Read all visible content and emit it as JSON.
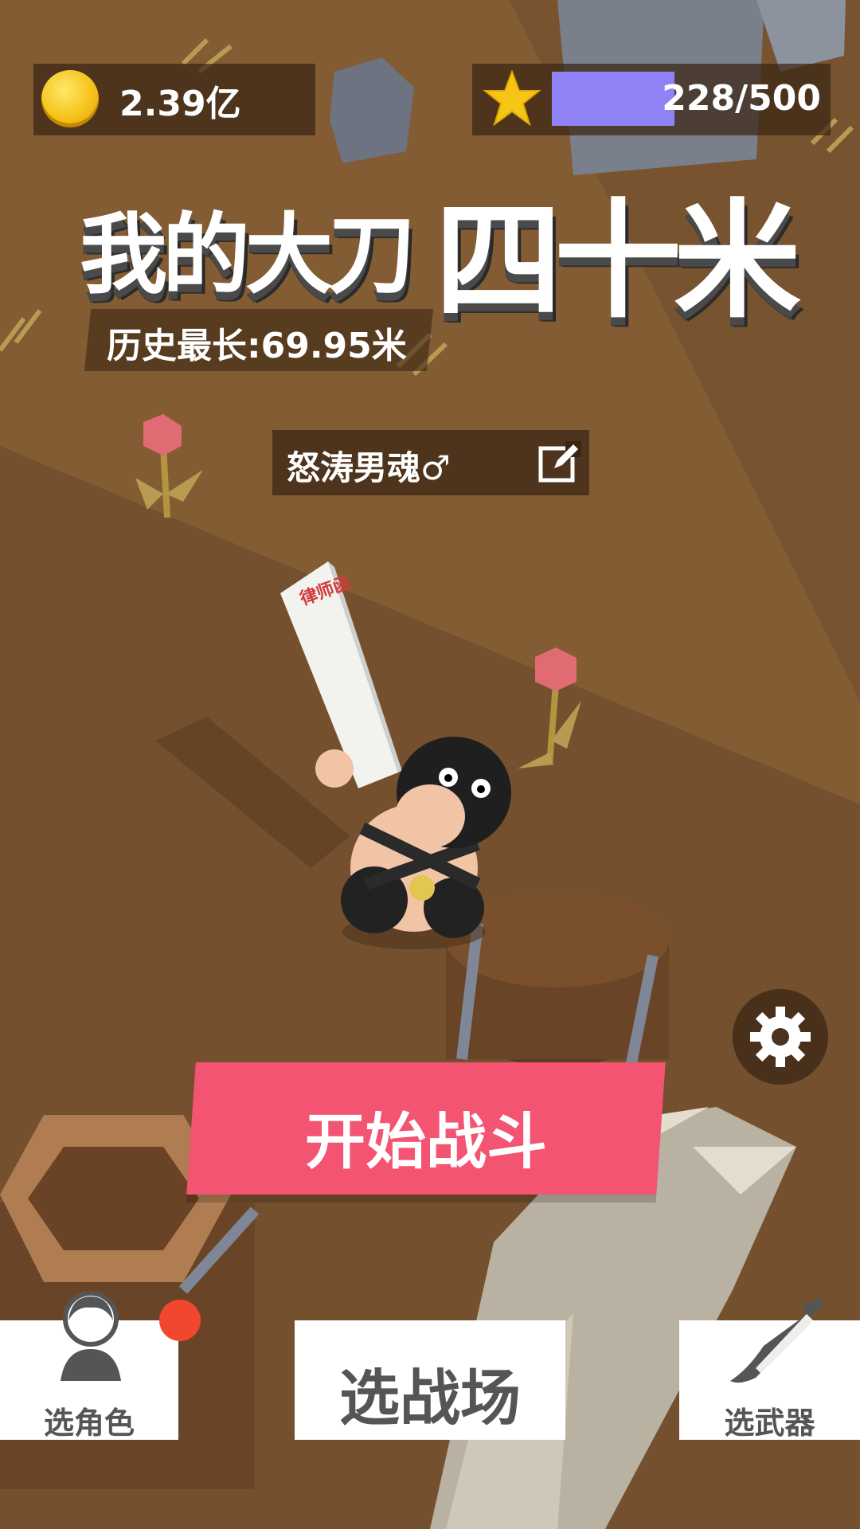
{
  "hud": {
    "coins": "2.39亿",
    "xp_text": "228/500",
    "xp_progress": 0.456
  },
  "title": {
    "part1": "我的大刀",
    "part2": "四十米"
  },
  "record": {
    "text": "历史最长:69.95米"
  },
  "player": {
    "name": "怒涛男魂♂"
  },
  "buttons": {
    "start": "开始战斗",
    "select_character": "选角色",
    "select_field": "选战场",
    "select_weapon": "选武器"
  },
  "weapon_label": "律师函",
  "colors": {
    "start_button": "#f35472",
    "xp_fill": "#8f82f6",
    "notification_dot": "#f2472f",
    "ground": "#7a5631"
  },
  "icons": {
    "coin": "coin-icon",
    "star": "star-icon",
    "edit": "edit-icon",
    "settings": "gear-icon",
    "character": "person-icon",
    "weapon": "knife-icon"
  }
}
